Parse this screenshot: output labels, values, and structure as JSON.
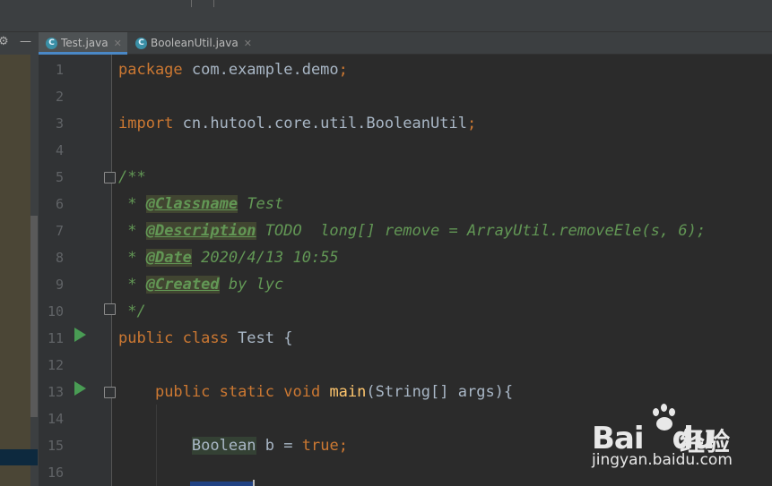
{
  "tabs": [
    {
      "label": "Test.java",
      "icon": "java-class-icon",
      "active": true
    },
    {
      "label": "BooleanUtil.java",
      "icon": "java-class-icon",
      "active": false
    }
  ],
  "tool_icons": {
    "settings": "⚙",
    "minimize": "—"
  },
  "line_numbers": [
    "1",
    "2",
    "3",
    "4",
    "5",
    "6",
    "7",
    "8",
    "9",
    "10",
    "11",
    "12",
    "13",
    "14",
    "15",
    "16"
  ],
  "code": {
    "l1": {
      "kw": "package",
      "rest": " com.example.demo",
      "semi": ";"
    },
    "l3": {
      "kw": "import",
      "rest": " cn.hutool.core.util.BooleanUtil",
      "semi": ";"
    },
    "l5": {
      "text": "/**"
    },
    "l6": {
      "prefix": " * ",
      "tag": "@Classname",
      "text": " Test"
    },
    "l7": {
      "prefix": " * ",
      "tag": "@Description",
      "text": " TODO  long[] remove = ArrayUtil.removeEle(s, 6);"
    },
    "l8": {
      "prefix": " * ",
      "tag": "@Date",
      "text": " 2020/4/13 10:55"
    },
    "l9": {
      "prefix": " * ",
      "tag": "@Created",
      "text": " by lyc"
    },
    "l10": {
      "text": " */"
    },
    "l11": {
      "kw": "public class",
      "rest": " Test {"
    },
    "l13": {
      "indent": "    ",
      "kw": "public static void",
      "sp": " ",
      "fn": "main",
      "rest": "(String[] args){"
    },
    "l15": {
      "indent": "        ",
      "type": "Boolean",
      "mid": " b = ",
      "kw": "true",
      "semi": ";"
    }
  },
  "watermark": {
    "logo_left": "Bai",
    "logo_right": "du",
    "cn": "经验",
    "url": "jingyan.baidu.com"
  },
  "colors": {
    "keyword": "#cc7832",
    "doc": "#629755",
    "function": "#ffc66d",
    "text": "#a9b7c6",
    "tab_accent": "#4a88c7"
  }
}
